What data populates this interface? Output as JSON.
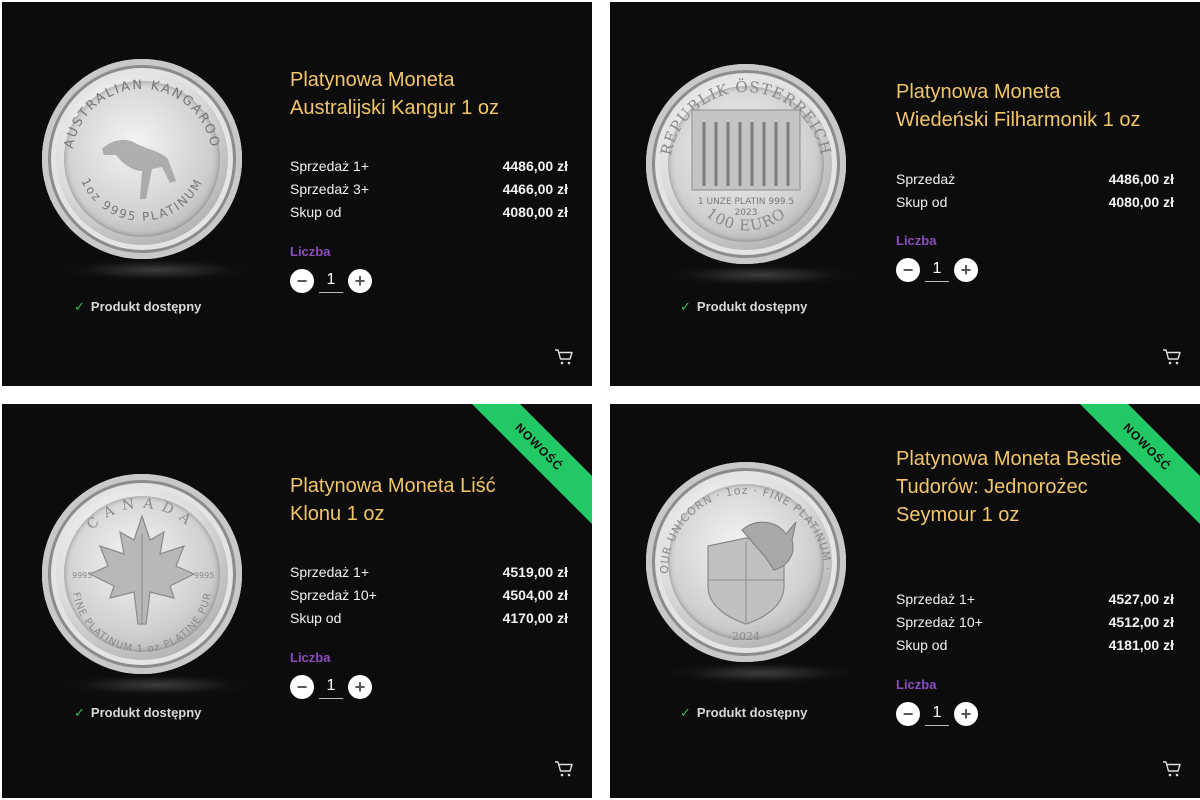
{
  "colors": {
    "card_bg": "#0c0c0c",
    "title": "#f3c66a",
    "qty_label": "#8a4cc0",
    "available_check": "#2fbf5a",
    "ribbon": "#22c863"
  },
  "products": [
    {
      "title": "Platynowa Moneta Australijski Kangur 1 oz",
      "prices": [
        {
          "label": "Sprzedaż 1+",
          "value": "4486,00 zł"
        },
        {
          "label": "Sprzedaż 3+",
          "value": "4466,00 zł"
        },
        {
          "label": "Skup od",
          "value": "4080,00 zł"
        }
      ],
      "qty_label": "Liczba",
      "qty_value": "1",
      "available": "Produkt dostępny",
      "coin_text_top": "AUSTRALIAN KANGAROO",
      "coin_text_bottom": "1oz 9995 PLATINUM"
    },
    {
      "title": "Platynowa Moneta Wiedeński Filharmonik 1 oz",
      "prices": [
        {
          "label": "Sprzedaż",
          "value": "4486,00 zł"
        },
        {
          "label": "Skup od",
          "value": "4080,00 zł"
        }
      ],
      "qty_label": "Liczba",
      "qty_value": "1",
      "available": "Produkt dostępny",
      "coin_text_top": "REPUBLIK ÖSTERREICH",
      "coin_text_mid": "1 UNZE PLATIN 999.5",
      "coin_text_year": "2023",
      "coin_text_bottom": "100 EURO"
    },
    {
      "title": "Platynowa Moneta Liść Klonu 1 oz",
      "prices": [
        {
          "label": "Sprzedaż 1+",
          "value": "4519,00 zł"
        },
        {
          "label": "Sprzedaż 10+",
          "value": "4504,00 zł"
        },
        {
          "label": "Skup od",
          "value": "4170,00 zł"
        }
      ],
      "qty_label": "Liczba",
      "qty_value": "1",
      "available": "Produkt dostępny",
      "badge": "NOWOŚĆ",
      "coin_text_top": "CANADA",
      "coin_text_bottom": "FINE PLATINUM 1 oz PLATINE PUR",
      "coin_text_left": "9995",
      "coin_text_right": "9995"
    },
    {
      "title": "Platynowa Moneta Bestie Tudorów: Jednorożec Seymour 1 oz",
      "prices": [
        {
          "label": "Sprzedaż 1+",
          "value": "4527,00 zł"
        },
        {
          "label": "Sprzedaż 10+",
          "value": "4512,00 zł"
        },
        {
          "label": "Skup od",
          "value": "4181,00 zł"
        }
      ],
      "qty_label": "Liczba",
      "qty_value": "1",
      "available": "Produkt dostępny",
      "badge": "NOWOŚĆ",
      "coin_text_top": "SEYMOUR UNICORN · 1oz · FINE PLATINUM · 9995",
      "coin_text_year": "2024"
    }
  ]
}
